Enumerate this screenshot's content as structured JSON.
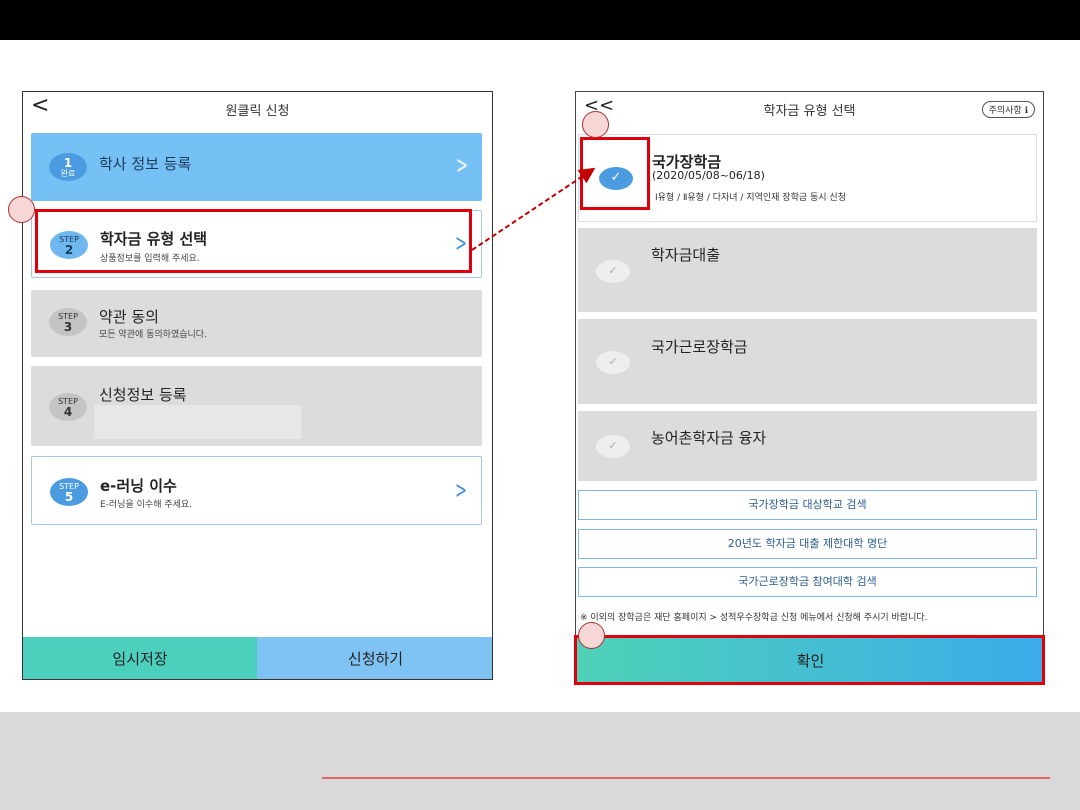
{
  "left_screen": {
    "title": "원클릭 신청",
    "back_glyph": "<",
    "steps": [
      {
        "badge_top": "1",
        "badge_bottom": "완료",
        "label": "학사 정보 등록",
        "sub": ""
      },
      {
        "badge_top": "STEP",
        "badge_bottom": "2",
        "label": "학자금 유형 선택",
        "sub": "상품정보를 입력해 주세요."
      },
      {
        "badge_top": "STEP",
        "badge_bottom": "3",
        "label": "약관 동의",
        "sub": "모든 약관에 동의하였습니다."
      },
      {
        "badge_top": "STEP",
        "badge_bottom": "4",
        "label": "신청정보 등록",
        "sub": ""
      },
      {
        "badge_top": "STEP",
        "badge_bottom": "5",
        "label": "e-러닝 이수",
        "sub": "E-러닝을 이수해 주세요."
      }
    ],
    "chevron_glyph": ">",
    "temp_save_label": "임시저장",
    "apply_label": "신청하기"
  },
  "right_screen": {
    "title": "학자금 유형 선택",
    "back_glyph": "<<",
    "notice_label": "주의사항 ℹ",
    "options": [
      {
        "label": "국가장학금",
        "date": "(2020/05/08~06/18)",
        "desc": "Ⅰ유형 / Ⅱ유형 / 다자녀 / 지역인재 장학금 동시 신청",
        "selected": true
      },
      {
        "label": "학자금대출",
        "selected": false
      },
      {
        "label": "국가근로장학금",
        "selected": false
      },
      {
        "label": "농어촌학자금 융자",
        "selected": false
      }
    ],
    "check_glyph": "✓",
    "links": [
      "국가장학금 대상학교 검색",
      "20년도 학자금 대출 제한대학 명단",
      "국가근로장학금 참여대학 검색"
    ],
    "note": "※ 이외의 장학금은 재단 홈페이지 > 성적우수장학금 신청 메뉴에서 신청해 주시기 바랍니다.",
    "confirm_label": "확인"
  },
  "colors": {
    "highlight": "#e0000c",
    "teal": "#4dcfbd",
    "sky": "#7fc3f3",
    "blue_badge": "#4a9be0"
  }
}
